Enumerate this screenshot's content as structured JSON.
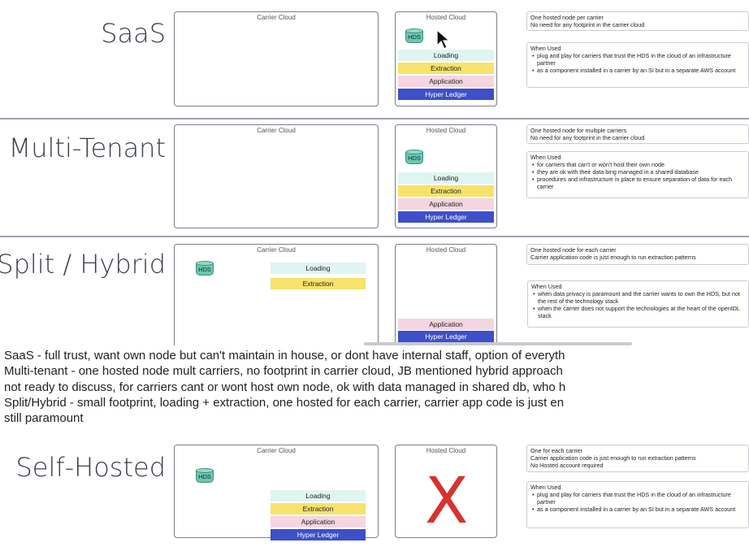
{
  "labels": {
    "carrier_cloud": "Carrier Cloud",
    "hosted_cloud": "Hosted Cloud",
    "hds": "HDS",
    "loading": "Loading",
    "extraction": "Extraction",
    "application": "Application",
    "hyper_ledger": "Hyper Ledger",
    "when_used": "When Used",
    "not_applicable_mark": "X"
  },
  "sections": {
    "saas": {
      "title": "SaaS",
      "summary": [
        "One hosted node per carrier",
        "No need for any footprint in the carrier cloud"
      ],
      "when_used": [
        "plug and play for carriers that trust the HDS in the cloud of an infrastructure partner",
        "as a component installed in a carrier by an SI but in a separate AWS account"
      ]
    },
    "multi_tenant": {
      "title": "Multi-Tenant",
      "summary": [
        "One hosted node for multiple carriers",
        "No need for any footprint in the carrier cloud"
      ],
      "when_used": [
        "for carriers that can't or won't host their own node",
        "they are ok with their data bing managed in a shared database",
        "procedures and infrastructure in place to ensure separation of data for each carrier"
      ]
    },
    "split_hybrid": {
      "title": "Split / Hybrid",
      "summary": [
        "One hosted node for each carrier",
        "Carrier application code is just enough to run extraction patterns"
      ],
      "when_used": [
        "when data privacy is paramount and the carrier wants to own the HDS, but not the rest of the technology stack",
        "when the carrier does not support the technologies at the heart of the openIDL stack"
      ]
    },
    "self_hosted": {
      "title": "Self-Hosted",
      "summary": [
        "One for each carrier",
        "Carrier application code is just enough to run extraction patterns",
        "No Hosted account required"
      ],
      "when_used": [
        "plug and play for carriers that trust the HDS in the cloud of an infrastructure partner",
        "as a component installed in a carrier by an SI but in a separate AWS account"
      ]
    }
  },
  "notes": [
    "SaaS - full trust, want own node but can't maintain in house, or dont have internal staff, option of everyth",
    "Multi-tenant - one hosted node mult carriers, no footprint in carrier cloud, JB mentioned hybrid approach",
    "not ready to discuss, for carriers cant or wont host own node, ok with data managed in shared db, who h",
    "Split/Hybrid - small footprint, loading + extraction, one hosted for each carrier, carrier app code is just en",
    "still paramount"
  ],
  "colors": {
    "loading": "#dff5f2",
    "extraction": "#f7e26b",
    "application": "#f5d5e0",
    "hyper_ledger": "#3d4fc9",
    "hds": "#6cc7b0",
    "x_mark": "#d8322e"
  },
  "icons": [
    "database-icon",
    "mouse-pointer-icon"
  ]
}
